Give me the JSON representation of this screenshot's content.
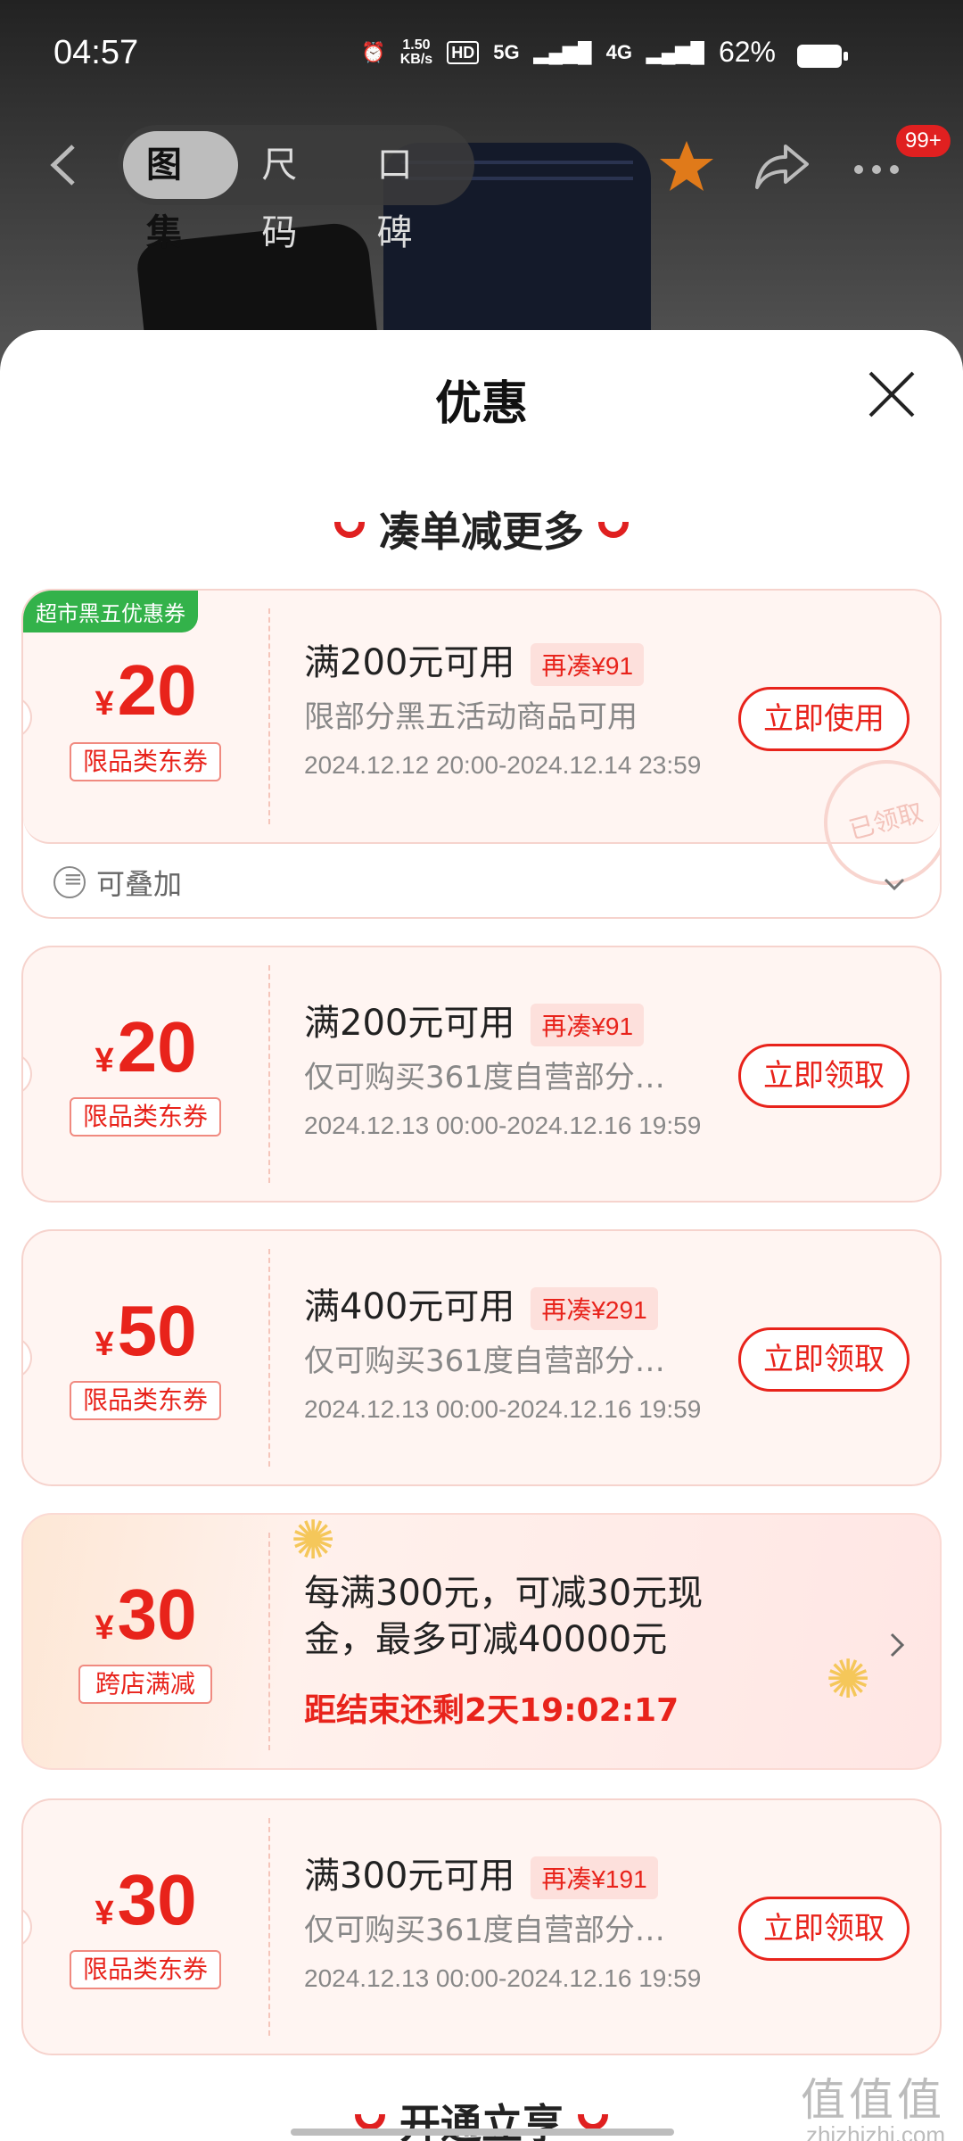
{
  "status": {
    "time": "04:57",
    "net_speed_top": "1.50",
    "net_speed_bottom": "KB/s",
    "hd": "HD",
    "net_5g": "5G",
    "net_4g": "4G",
    "battery": "62%"
  },
  "nav": {
    "tabs": [
      "图集",
      "尺码",
      "口碑"
    ],
    "badge": "99+"
  },
  "sheet": {
    "title": "优惠",
    "section_title": "凑单减更多",
    "bottom_section_title": "开通立享"
  },
  "coupons": [
    {
      "corner_tag": "超市黑五优惠券",
      "yen": "¥",
      "amount": "20",
      "label": "限品类东券",
      "condition": "满200元可用",
      "more": "再凑¥91",
      "desc": "限部分黑五活动商品可用",
      "date": "2024.12.12 20:00-2024.12.14 23:59",
      "button": "立即使用",
      "stamp": "已领取",
      "stackable": "可叠加"
    },
    {
      "yen": "¥",
      "amount": "20",
      "label": "限品类东券",
      "condition": "满200元可用",
      "more": "再凑¥91",
      "desc": "仅可购买361度自营部分…",
      "date": "2024.12.13 00:00-2024.12.16 19:59",
      "button": "立即领取"
    },
    {
      "yen": "¥",
      "amount": "50",
      "label": "限品类东券",
      "condition": "满400元可用",
      "more": "再凑¥291",
      "desc": "仅可购买361度自营部分…",
      "date": "2024.12.13 00:00-2024.12.16 19:59",
      "button": "立即领取"
    },
    {
      "yen": "¥",
      "amount": "30",
      "label": "跨店满减",
      "promo_line1": "每满300元，可减30元现",
      "promo_line2": "金，最多可减40000元",
      "countdown": "距结束还剩2天19:02:17"
    },
    {
      "yen": "¥",
      "amount": "30",
      "label": "限品类东券",
      "condition": "满300元可用",
      "more": "再凑¥191",
      "desc": "仅可购买361度自营部分…",
      "date": "2024.12.13 00:00-2024.12.16 19:59",
      "button": "立即领取"
    }
  ],
  "watermark": {
    "big": "值值值",
    "small": "zhizhizhi.com"
  }
}
